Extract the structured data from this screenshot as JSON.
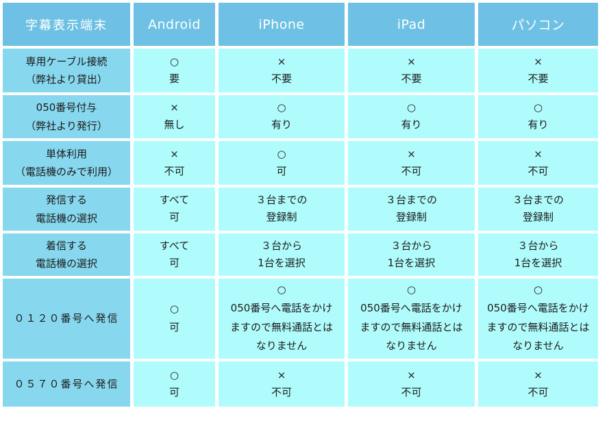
{
  "table": {
    "columns": [
      {
        "key": "label",
        "header": "字幕表示端末"
      },
      {
        "key": "android",
        "header": "Android"
      },
      {
        "key": "iphone",
        "header": "iPhone"
      },
      {
        "key": "ipad",
        "header": "iPad"
      },
      {
        "key": "pc",
        "header": "パソコン"
      }
    ],
    "rows": [
      {
        "label_line1": "専用ケーブル接続",
        "label_line2": "（弊社より貸出）",
        "android_mark": "○",
        "android_value": "要",
        "iphone_mark": "×",
        "iphone_value": "不要",
        "ipad_mark": "×",
        "ipad_value": "不要",
        "pc_mark": "×",
        "pc_value": "不要"
      },
      {
        "label_line1": "050番号付与",
        "label_line2": "（弊社より発行）",
        "android_mark": "×",
        "android_value": "無し",
        "iphone_mark": "○",
        "iphone_value": "有り",
        "ipad_mark": "○",
        "ipad_value": "有り",
        "pc_mark": "○",
        "pc_value": "有り"
      },
      {
        "label_line1": "単体利用",
        "label_line2": "（電話機のみで利用）",
        "android_mark": "×",
        "android_value": "不可",
        "iphone_mark": "○",
        "iphone_value": "可",
        "ipad_mark": "×",
        "ipad_value": "不可",
        "pc_mark": "×",
        "pc_value": "不可"
      },
      {
        "label_line1": "発信する",
        "label_line2": "電話機の選択",
        "android_mark": "すべて",
        "android_value": "可",
        "iphone_mark": "３台までの",
        "iphone_value": "登録制",
        "ipad_mark": "３台までの",
        "ipad_value": "登録制",
        "pc_mark": "３台までの",
        "pc_value": "登録制"
      },
      {
        "label_line1": "着信する",
        "label_line2": "電話機の選択",
        "android_mark": "すべて",
        "android_value": "可",
        "iphone_mark": "３台から",
        "iphone_value": "1台を選択",
        "ipad_mark": "３台から",
        "ipad_value": "1台を選択",
        "pc_mark": "３台から",
        "pc_value": "1台を選択"
      },
      {
        "label_line1": "０１２０番号へ発信",
        "label_line2": "",
        "android_mark": "○",
        "android_value": "可",
        "iphone_mark": "○",
        "iphone_value": "050番号へ電話をかけますので無料通話とはなりません",
        "ipad_mark": "○",
        "ipad_value": "050番号へ電話をかけますので無料通話とはなりません",
        "pc_mark": "○",
        "pc_value": "050番号へ電話をかけますので無料通話とはなりません"
      },
      {
        "label_line1": "０５７０番号へ発信",
        "label_line2": "",
        "android_mark": "○",
        "android_value": "可",
        "iphone_mark": "×",
        "iphone_value": "不可",
        "ipad_mark": "×",
        "ipad_value": "不可",
        "pc_mark": "×",
        "pc_value": "不可"
      }
    ]
  },
  "colors": {
    "header_bg": "#6ec1e4",
    "rowlabel_bg": "#87d8ef",
    "data_bg": "#b0fcfc",
    "header_text": "#ffffff",
    "body_text": "#1a1a1a",
    "page_bg": "#ffffff"
  }
}
